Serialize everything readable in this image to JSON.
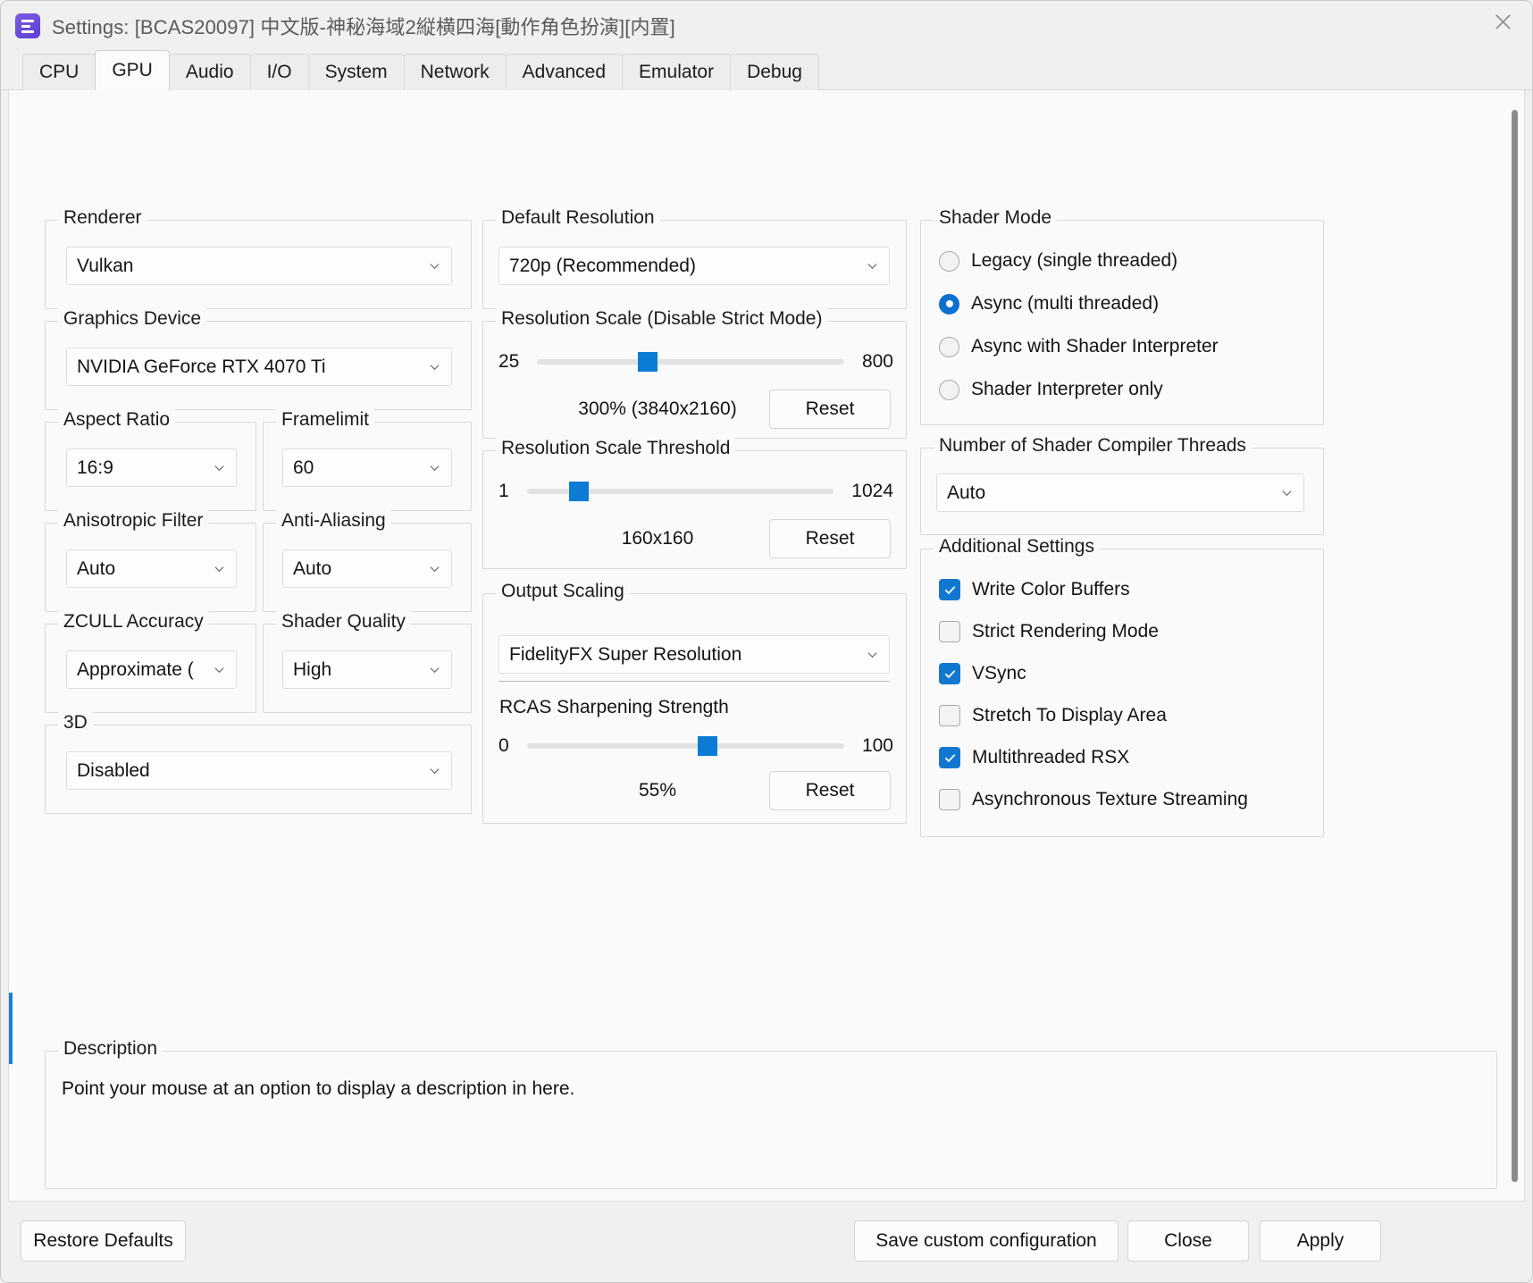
{
  "window": {
    "title": "Settings: [BCAS20097] 中文版-神秘海域2縦横四海[動作角色扮演][内置]",
    "app_icon": "rpcs3-logo-icon",
    "close_icon": "close-icon",
    "accent_color": "#0b7bd4"
  },
  "tabs": [
    {
      "label": "CPU",
      "active": false
    },
    {
      "label": "GPU",
      "active": true
    },
    {
      "label": "Audio",
      "active": false
    },
    {
      "label": "I/O",
      "active": false
    },
    {
      "label": "System",
      "active": false
    },
    {
      "label": "Network",
      "active": false
    },
    {
      "label": "Advanced",
      "active": false
    },
    {
      "label": "Emulator",
      "active": false
    },
    {
      "label": "Debug",
      "active": false
    }
  ],
  "left_column": {
    "renderer": {
      "title": "Renderer",
      "value": "Vulkan"
    },
    "graphics_device": {
      "title": "Graphics Device",
      "value": "NVIDIA GeForce RTX 4070 Ti"
    },
    "aspect_ratio": {
      "title": "Aspect Ratio",
      "value": "16:9"
    },
    "framelimit": {
      "title": "Framelimit",
      "value": "60"
    },
    "anisotropic_filter": {
      "title": "Anisotropic Filter",
      "value": "Auto"
    },
    "anti_aliasing": {
      "title": "Anti-Aliasing",
      "value": "Auto"
    },
    "zcull_accuracy": {
      "title": "ZCULL Accuracy",
      "value": "Approximate ("
    },
    "shader_quality": {
      "title": "Shader Quality",
      "value": "High"
    },
    "three_d": {
      "title": "3D",
      "value": "Disabled"
    }
  },
  "middle_column": {
    "default_resolution": {
      "title": "Default Resolution",
      "value": "720p (Recommended)"
    },
    "resolution_scale": {
      "title": "Resolution Scale (Disable Strict Mode)",
      "min": "25",
      "max": "800",
      "value_label": "300% (3840x2160)",
      "reset_label": "Reset",
      "handle_pct": 36
    },
    "resolution_scale_threshold": {
      "title": "Resolution Scale Threshold",
      "min": "1",
      "max": "1024",
      "value_label": "160x160",
      "reset_label": "Reset",
      "handle_pct": 17
    },
    "output_scaling": {
      "title": "Output Scaling",
      "value": "FidelityFX Super Resolution",
      "rcas_label": "RCAS Sharpening Strength",
      "min": "0",
      "max": "100",
      "value_label": "55%",
      "reset_label": "Reset",
      "handle_pct": 57
    }
  },
  "right_column": {
    "shader_mode": {
      "title": "Shader Mode",
      "options": [
        {
          "label": "Legacy (single threaded)",
          "selected": false
        },
        {
          "label": "Async (multi threaded)",
          "selected": true
        },
        {
          "label": "Async with Shader Interpreter",
          "selected": false
        },
        {
          "label": "Shader Interpreter only",
          "selected": false
        }
      ]
    },
    "shader_compiler_threads": {
      "title": "Number of Shader Compiler Threads",
      "value": "Auto"
    },
    "additional_settings": {
      "title": "Additional Settings",
      "options": [
        {
          "label": "Write Color Buffers",
          "checked": true
        },
        {
          "label": "Strict Rendering Mode",
          "checked": false
        },
        {
          "label": "VSync",
          "checked": true
        },
        {
          "label": "Stretch To Display Area",
          "checked": false
        },
        {
          "label": "Multithreaded RSX",
          "checked": true
        },
        {
          "label": "Asynchronous Texture Streaming",
          "checked": false
        }
      ]
    }
  },
  "description": {
    "title": "Description",
    "text": "Point your mouse at an option to display a description in here."
  },
  "footer": {
    "restore_defaults": "Restore Defaults",
    "save_custom_configuration": "Save custom configuration",
    "close": "Close",
    "apply": "Apply"
  }
}
